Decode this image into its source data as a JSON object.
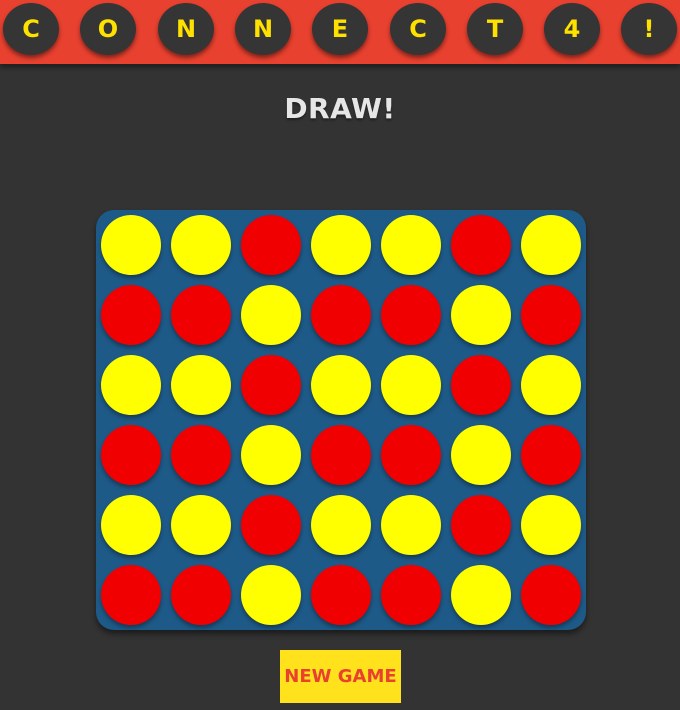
{
  "header": {
    "letters": [
      "C",
      "O",
      "N",
      "N",
      "E",
      "C",
      "T",
      "4",
      "!"
    ]
  },
  "status": {
    "text": "DRAW!"
  },
  "board": {
    "rows": [
      [
        "yellow",
        "yellow",
        "red",
        "yellow",
        "yellow",
        "red",
        "yellow"
      ],
      [
        "red",
        "red",
        "yellow",
        "red",
        "red",
        "yellow",
        "red"
      ],
      [
        "yellow",
        "yellow",
        "red",
        "yellow",
        "yellow",
        "red",
        "yellow"
      ],
      [
        "red",
        "red",
        "yellow",
        "red",
        "red",
        "yellow",
        "red"
      ],
      [
        "yellow",
        "yellow",
        "red",
        "yellow",
        "yellow",
        "red",
        "yellow"
      ],
      [
        "red",
        "red",
        "yellow",
        "red",
        "red",
        "yellow",
        "red"
      ]
    ]
  },
  "colors": {
    "header": "#e8412f",
    "background": "#333333",
    "board": "#1e5a88",
    "red": "#f00000",
    "yellow": "#ffff00",
    "button": "#ffe11c",
    "button_text": "#e8412f"
  },
  "controls": {
    "new_game_label": "NEW GAME"
  }
}
